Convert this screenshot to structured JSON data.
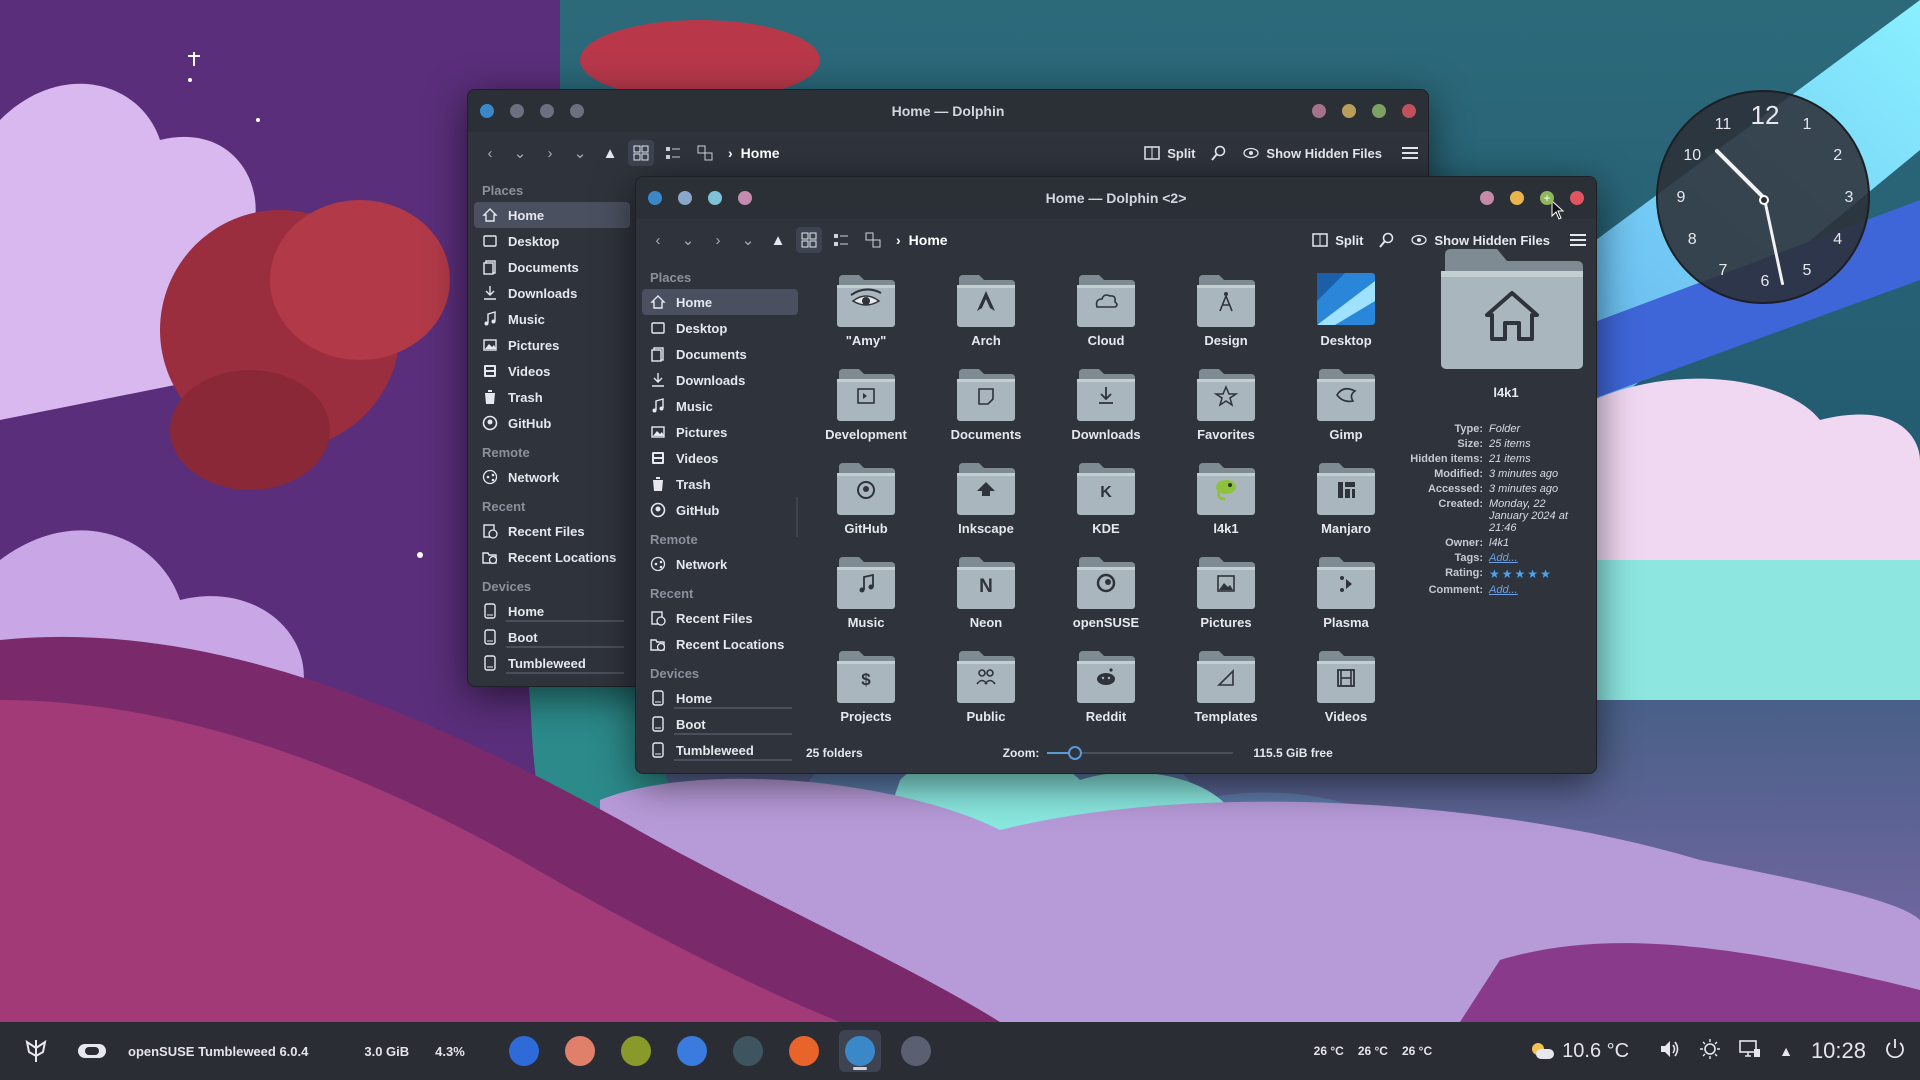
{
  "back_window": {
    "title": "Home — Dolphin",
    "breadcrumb": "Home",
    "toolbar": {
      "split_label": "Split",
      "hidden_label": "Show Hidden Files"
    },
    "places_header": "Places",
    "places": [
      {
        "label": "Home",
        "icon": "home-icon"
      },
      {
        "label": "Desktop",
        "icon": "desktop-icon"
      },
      {
        "label": "Documents",
        "icon": "documents-icon"
      },
      {
        "label": "Downloads",
        "icon": "downloads-icon"
      },
      {
        "label": "Music",
        "icon": "music-icon"
      },
      {
        "label": "Pictures",
        "icon": "pictures-icon"
      },
      {
        "label": "Videos",
        "icon": "videos-icon"
      },
      {
        "label": "Trash",
        "icon": "trash-icon"
      },
      {
        "label": "GitHub",
        "icon": "github-icon"
      }
    ],
    "remote_header": "Remote",
    "remote": [
      {
        "label": "Network",
        "icon": "network-icon"
      }
    ],
    "recent_header": "Recent",
    "recent": [
      {
        "label": "Recent Files",
        "icon": "recent-files-icon"
      },
      {
        "label": "Recent Locations",
        "icon": "recent-locations-icon"
      }
    ],
    "devices_header": "Devices",
    "devices": [
      {
        "label": "Home",
        "icon": "drive-icon"
      },
      {
        "label": "Boot",
        "icon": "drive-icon"
      },
      {
        "label": "Tumbleweed",
        "icon": "drive-icon"
      }
    ]
  },
  "front_window": {
    "title": "Home — Dolphin <2>",
    "breadcrumb": "Home",
    "toolbar": {
      "split_label": "Split",
      "hidden_label": "Show Hidden Files"
    },
    "places_header": "Places",
    "places": [
      {
        "label": "Home",
        "icon": "home-icon"
      },
      {
        "label": "Desktop",
        "icon": "desktop-icon"
      },
      {
        "label": "Documents",
        "icon": "documents-icon"
      },
      {
        "label": "Downloads",
        "icon": "downloads-icon"
      },
      {
        "label": "Music",
        "icon": "music-icon"
      },
      {
        "label": "Pictures",
        "icon": "pictures-icon"
      },
      {
        "label": "Videos",
        "icon": "videos-icon"
      },
      {
        "label": "Trash",
        "icon": "trash-icon"
      },
      {
        "label": "GitHub",
        "icon": "github-icon"
      }
    ],
    "remote_header": "Remote",
    "remote": [
      {
        "label": "Network",
        "icon": "network-icon"
      }
    ],
    "recent_header": "Recent",
    "recent": [
      {
        "label": "Recent Files",
        "icon": "recent-files-icon"
      },
      {
        "label": "Recent Locations",
        "icon": "recent-locations-icon"
      }
    ],
    "devices_header": "Devices",
    "devices": [
      {
        "label": "Home",
        "icon": "drive-icon"
      },
      {
        "label": "Boot",
        "icon": "drive-icon"
      },
      {
        "label": "Tumbleweed",
        "icon": "drive-icon"
      }
    ],
    "folders": [
      {
        "name": "\"Amy\"",
        "icon": "eye-icon"
      },
      {
        "name": "Arch",
        "icon": "arch-icon"
      },
      {
        "name": "Cloud",
        "icon": "cloud-icon"
      },
      {
        "name": "Design",
        "icon": "compass-icon"
      },
      {
        "name": "Desktop",
        "icon": "desktop-wallpaper-icon"
      },
      {
        "name": "Development",
        "icon": "terminal-icon"
      },
      {
        "name": "Documents",
        "icon": "document-icon"
      },
      {
        "name": "Downloads",
        "icon": "download-icon"
      },
      {
        "name": "Favorites",
        "icon": "star-icon"
      },
      {
        "name": "Gimp",
        "icon": "gimp-icon"
      },
      {
        "name": "GitHub",
        "icon": "github-icon"
      },
      {
        "name": "Inkscape",
        "icon": "inkscape-icon"
      },
      {
        "name": "KDE",
        "icon": "kde-icon"
      },
      {
        "name": "l4k1",
        "icon": "chameleon-icon"
      },
      {
        "name": "Manjaro",
        "icon": "manjaro-icon"
      },
      {
        "name": "Music",
        "icon": "music-note-icon"
      },
      {
        "name": "Neon",
        "icon": "neon-icon"
      },
      {
        "name": "openSUSE",
        "icon": "opensuse-icon"
      },
      {
        "name": "Pictures",
        "icon": "image-icon"
      },
      {
        "name": "Plasma",
        "icon": "plasma-icon"
      },
      {
        "name": "Projects",
        "icon": "dollar-icon"
      },
      {
        "name": "Public",
        "icon": "people-icon"
      },
      {
        "name": "Reddit",
        "icon": "reddit-icon"
      },
      {
        "name": "Templates",
        "icon": "template-icon"
      },
      {
        "name": "Videos",
        "icon": "film-icon"
      }
    ],
    "info_panel": {
      "name": "l4k1",
      "rows": [
        {
          "key": "Type:",
          "value": "Folder"
        },
        {
          "key": "Size:",
          "value": "25 items"
        },
        {
          "key": "Hidden items:",
          "value": "21 items"
        },
        {
          "key": "Modified:",
          "value": "3 minutes ago"
        },
        {
          "key": "Accessed:",
          "value": "3 minutes ago"
        },
        {
          "key": "Created:",
          "value": "Monday, 22 January 2024 at 21:46"
        },
        {
          "key": "Owner:",
          "value": "l4k1"
        }
      ],
      "tags_key": "Tags:",
      "tags_value": "Add...",
      "rating_key": "Rating:",
      "rating": 5,
      "rating_max": 5,
      "comment_key": "Comment:",
      "comment_value": "Add..."
    },
    "status": {
      "folders": "25 folders",
      "zoom_label": "Zoom:",
      "zoom_level": 0.15,
      "free": "115.5 GiB free"
    }
  },
  "clock": {
    "numbers": [
      "12",
      "1",
      "2",
      "3",
      "4",
      "5",
      "6",
      "7",
      "8",
      "9",
      "10",
      "11"
    ],
    "time": "10:28"
  },
  "taskbar": {
    "distro": "openSUSE Tumbleweed 6.0.4",
    "memory": "3.0 GiB",
    "cpu": "4.3%",
    "apps": [
      {
        "name": "system-monitor-icon",
        "color": "#2f6bd8"
      },
      {
        "name": "discover-icon",
        "color": "#e0806a"
      },
      {
        "name": "gecko-icon",
        "color": "#8a9a2a"
      },
      {
        "name": "shop-icon",
        "color": "#3a7be0"
      },
      {
        "name": "settings-icon",
        "color": "#3e5560"
      },
      {
        "name": "firefox-icon",
        "color": "#e8642a"
      },
      {
        "name": "dolphin-icon",
        "color": "#3b88c9"
      },
      {
        "name": "tools-icon",
        "color": "#5a5f72"
      }
    ],
    "temps": [
      "26 °C",
      "26 °C",
      "26 °C"
    ],
    "weather": "10.6 °C",
    "time": "10:28"
  },
  "colors": {
    "close": "#e05561",
    "minimize": "#e8b44b",
    "maximize": "#8fb85c",
    "accent": "#4a5060"
  }
}
